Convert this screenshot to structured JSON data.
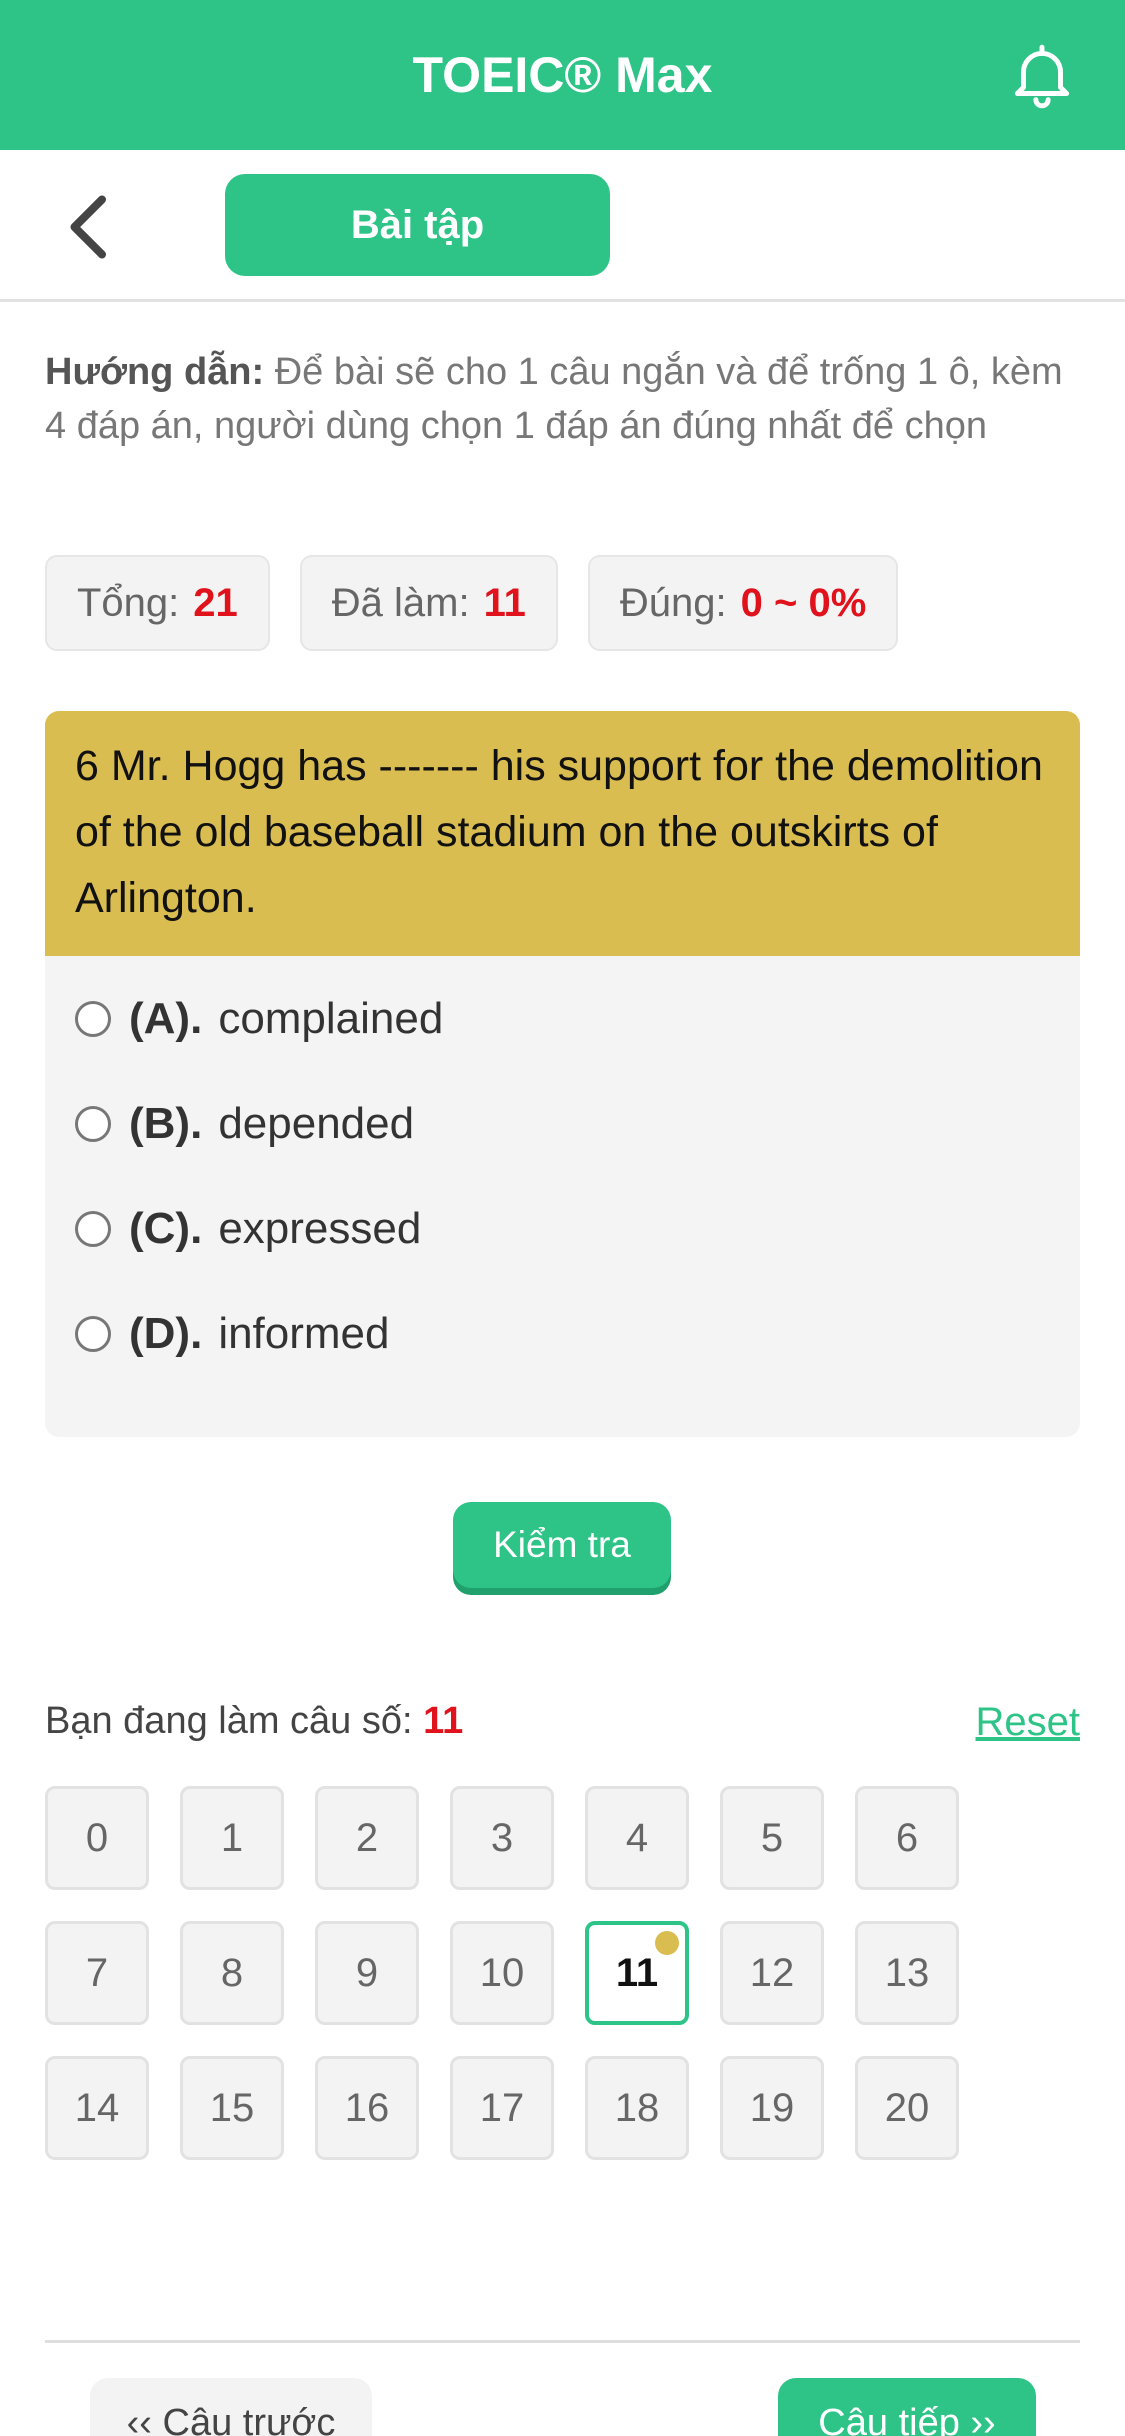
{
  "header": {
    "title": "TOEIC® Max",
    "notification_icon": "bell-icon"
  },
  "subheader": {
    "back_icon": "chevron-left-icon",
    "tab_label": "Bài tập"
  },
  "instructions": {
    "label": "Hướng dẫn:",
    "text": " Để bài sẽ cho 1 câu ngắn và để trống 1 ô, kèm 4 đáp án, người dùng chọn 1 đáp án đúng nhất để chọn"
  },
  "stats": [
    {
      "label": "Tổng:",
      "value": "21"
    },
    {
      "label": "Đã làm:",
      "value": "11"
    },
    {
      "label": "Đúng:",
      "value": "0 ~ 0%"
    }
  ],
  "question": {
    "text": "6 Mr. Hogg has ------- his support for the demolition of the old baseball stadium on the outskirts of Arlington.",
    "options": [
      {
        "letter": "(A).",
        "text": "complained",
        "selected": false
      },
      {
        "letter": "(B).",
        "text": "depended",
        "selected": false
      },
      {
        "letter": "(C).",
        "text": "expressed",
        "selected": false
      },
      {
        "letter": "(D).",
        "text": "informed",
        "selected": false
      }
    ]
  },
  "check_button": "Kiểm tra",
  "progress": {
    "label": "Bạn đang làm câu số: ",
    "current": "11",
    "reset_label": "Reset"
  },
  "question_numbers": [
    "0",
    "1",
    "2",
    "3",
    "4",
    "5",
    "6",
    "7",
    "8",
    "9",
    "10",
    "11",
    "12",
    "13",
    "14",
    "15",
    "16",
    "17",
    "18",
    "19",
    "20"
  ],
  "current_question": "11",
  "navigation": {
    "prev_label": "‹‹ Câu trước",
    "next_label": "Câu tiếp ››"
  },
  "colors": {
    "brand": "#2ec487",
    "question_header": "#d9bd50",
    "highlight": "#e0121b"
  }
}
